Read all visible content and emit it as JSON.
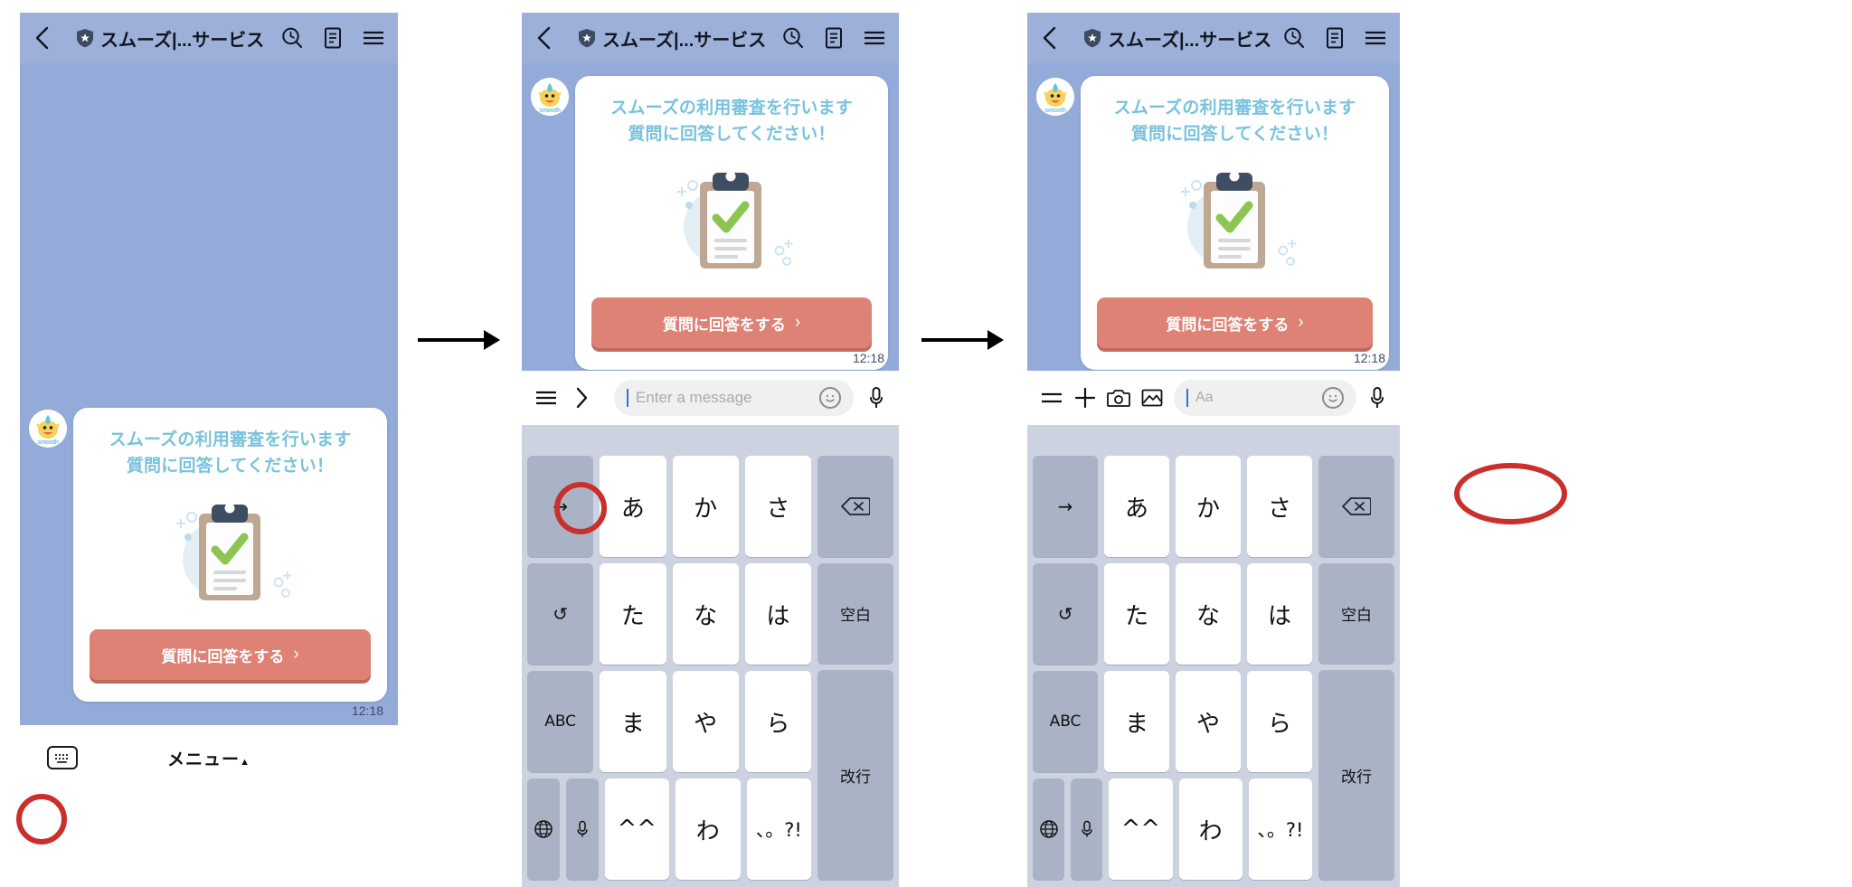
{
  "header": {
    "back_icon": "back-chevron-icon",
    "shield_icon": "verified-shield-icon",
    "title": "スムーズ|...サービス",
    "search_icon": "search-clock-icon",
    "notes_icon": "notes-icon",
    "menu_icon": "hamburger-menu-icon"
  },
  "message": {
    "avatar_label": "smooth",
    "title_line1": "スムーズの利用審査を行います",
    "title_line2": "質問に回答してください！",
    "cta_label": "質問に回答をする",
    "cta_chevron": "›",
    "timestamp": "12:18"
  },
  "panel1": {
    "keyboard_toggle_icon": "keyboard-icon",
    "menu_label": "メニュー",
    "menu_caret": "▲"
  },
  "panel2": {
    "hamburger_icon": "hamburger-menu-icon",
    "expand_icon": "chevron-right-icon",
    "input_placeholder": "Enter a message",
    "emoji_icon": "smiley-icon",
    "mic_icon": "microphone-icon"
  },
  "panel3": {
    "hamburger_icon": "hamburger-menu-icon",
    "plus_icon": "plus-icon",
    "camera_icon": "camera-icon",
    "gallery_icon": "image-icon",
    "input_placeholder": "Aa",
    "emoji_icon": "smiley-icon",
    "mic_icon": "microphone-icon"
  },
  "keyboard": {
    "rows": [
      [
        {
          "label": "→",
          "type": "fn",
          "name": "key-arrow-right"
        },
        {
          "label": "あ",
          "type": "char",
          "name": "key-a"
        },
        {
          "label": "か",
          "type": "char",
          "name": "key-ka"
        },
        {
          "label": "さ",
          "type": "char",
          "name": "key-sa"
        }
      ],
      [
        {
          "label": "↺",
          "type": "fn",
          "name": "key-undo"
        },
        {
          "label": "た",
          "type": "char",
          "name": "key-ta"
        },
        {
          "label": "な",
          "type": "char",
          "name": "key-na"
        },
        {
          "label": "は",
          "type": "char",
          "name": "key-ha"
        }
      ],
      [
        {
          "label": "ABC",
          "type": "fn sm",
          "name": "key-abc"
        },
        {
          "label": "ま",
          "type": "char",
          "name": "key-ma"
        },
        {
          "label": "や",
          "type": "char",
          "name": "key-ya"
        },
        {
          "label": "ら",
          "type": "char",
          "name": "key-ra"
        }
      ],
      [
        {
          "label": "🌐",
          "type": "fn half",
          "name": "key-globe"
        },
        {
          "label": "🎤",
          "type": "fn half",
          "name": "key-mic"
        },
        {
          "label": "^^",
          "type": "char",
          "name": "key-kaomoji"
        },
        {
          "label": "わ",
          "type": "char",
          "name": "key-wa"
        },
        {
          "label": "、。?!",
          "type": "sym",
          "name": "key-punctuation"
        }
      ]
    ],
    "right_column": [
      {
        "label": "⌫",
        "type": "fn",
        "name": "key-backspace"
      },
      {
        "label": "空白",
        "type": "fn sm",
        "name": "key-space"
      },
      {
        "label": "改行",
        "type": "fn sm",
        "name": "key-enter"
      }
    ]
  },
  "flow": {
    "arrow1": "flow-arrow-1",
    "arrow2": "flow-arrow-2"
  },
  "colors": {
    "chat_bg": "#94aad8",
    "header_bg": "#9db0d9",
    "card_title": "#79c2dd",
    "cta_bg": "#dd8275",
    "cta_shadow": "#c0695e",
    "highlight": "#c9302c",
    "keyboard_bg": "#ccd2e0",
    "key_fn_bg": "#aab3c6"
  }
}
